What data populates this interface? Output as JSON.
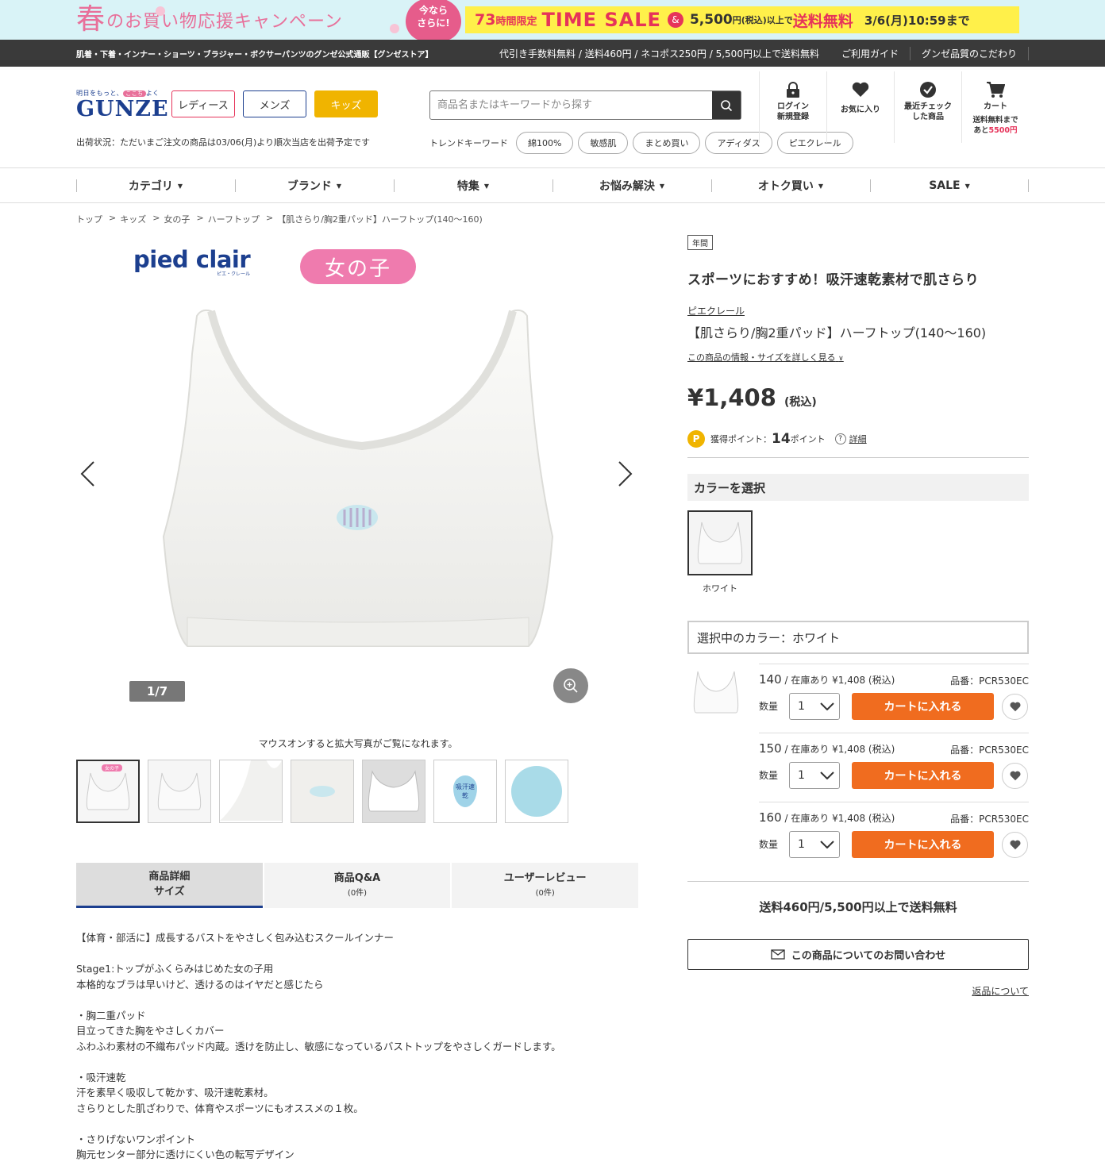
{
  "banner": {
    "spring_big": "春",
    "spring_rest": "のお買い物応援キャンペーン",
    "badge_l1": "今なら",
    "badge_l2": "さらに!",
    "hours": "73",
    "hours_suffix": "時間限定",
    "time_sale": "TIME SALE",
    "amp": "&",
    "threshold": "5,500",
    "threshold_suffix": "円(税込)以上で",
    "free": "送料無料",
    "date": "3/6(月)10:59まで"
  },
  "infobar": {
    "left": "肌着・下着・インナー・ショーツ・ブラジャー・ボクサーパンツのグンゼ公式通販【グンゼストア】",
    "shipping": "代引き手数料無料 / 送料460円 / ネコポス250円 / 5,500円以上で送料無料",
    "guide": "ご利用ガイド",
    "quality": "グンゼ品質のこだわり"
  },
  "header": {
    "logo_tag_pre": "明日をもっと、",
    "logo_tag_mid": "ここち",
    "logo_tag_post": "よく",
    "logo_word": "GUNZE",
    "ladies": "レディース",
    "mens": "メンズ",
    "kids": "キッズ",
    "ship_status": "出荷状況：ただいまご注文の商品は03/06(月)より順次当店を出荷予定です",
    "search_placeholder": "商品名またはキーワードから探す",
    "trend_label": "トレンドキーワード",
    "trends": [
      "綿100%",
      "敏感肌",
      "まとめ買い",
      "アディダス",
      "ピエクレール"
    ],
    "icons": {
      "login_l1": "ログイン",
      "login_l2": "新規登録",
      "fav": "お気に入り",
      "recent_l1": "最近チェック",
      "recent_l2": "した商品",
      "cart": "カート",
      "cart_note_l1": "送料無料まで",
      "cart_note_pre": "あと",
      "cart_note_amount": "5500円"
    }
  },
  "nav": [
    "カテゴリ",
    "ブランド",
    "特集",
    "お悩み解決",
    "オトク買い",
    "SALE"
  ],
  "breadcrumb": [
    "トップ",
    "キッズ",
    "女の子",
    "ハーフトップ",
    "【肌さらり/胸2重パッド】ハーフトップ(140〜160)"
  ],
  "gallery": {
    "brand_logo": "pied clair",
    "brand_logo_kana": "ピエ・クレール",
    "girl_label": "女の子",
    "counter": "1/7",
    "hover_note": "マウスオンすると拡大写真がご覧になれます。",
    "thumb_badge": "女の子",
    "thumb_drop": "吸汗速乾"
  },
  "tabs": [
    {
      "l1": "商品詳細",
      "l2": "サイズ"
    },
    {
      "l1": "商品Q&A",
      "l2": "(0件)"
    },
    {
      "l1": "ユーザーレビュー",
      "l2": "(0件)"
    }
  ],
  "description": [
    "【体育・部活に】成長するバストをやさしく包み込むスクールインナー",
    "",
    "Stage1:トップがふくらみはじめた女の子用",
    "本格的なブラは早いけど、透けるのはイヤだと感じたら",
    "",
    "・胸二重パッド",
    "目立ってきた胸をやさしくカバー",
    "ふわふわ素材の不織布パッド内蔵。透けを防止し、敏感になっているバストトップをやさしくガードします。",
    "",
    "・吸汗速乾",
    "汗を素早く吸収して乾かす、吸汗速乾素材。",
    "さらりとした肌ざわりで、体育やスポーツにもオススメの１枚。",
    "",
    "・さりげないワンポイント",
    "胸元センター部分に透けにくい色の転写デザイン"
  ],
  "product": {
    "season_tag": "年間",
    "catch": "スポーツにおすすめ！吸汗速乾素材で肌さらり",
    "brand": "ピエクレール",
    "name": "【肌さらり/胸2重パッド】ハーフトップ(140〜160)",
    "more_link": "この商品の情報・サイズを詳しく見る",
    "price": "¥1,408",
    "price_tax": "(税込)",
    "points_icon": "P",
    "points_label": "獲得ポイント：",
    "points_value": "14",
    "points_unit": "ポイント",
    "points_help": "?",
    "points_detail": "詳細",
    "color_heading": "カラーを選択",
    "color_name": "ホワイト",
    "selected_color": "選択中のカラー：ホワイト",
    "sizes": [
      {
        "size": "140",
        "stock": " / 在庫あり ¥1,408 (税込)",
        "code": "品番：PCR530EC",
        "qty_label": "数量",
        "qty": "1",
        "cart": "カートに入れる"
      },
      {
        "size": "150",
        "stock": " / 在庫あり ¥1,408 (税込)",
        "code": "品番：PCR530EC",
        "qty_label": "数量",
        "qty": "1",
        "cart": "カートに入れる"
      },
      {
        "size": "160",
        "stock": " / 在庫あり ¥1,408 (税込)",
        "code": "品番：PCR530EC",
        "qty_label": "数量",
        "qty": "1",
        "cart": "カートに入れる"
      }
    ],
    "shipping_note": "送料460円/5,500円以上で送料無料",
    "inquiry": "この商品についてのお問い合わせ",
    "returns": "返品について"
  },
  "colors": {
    "accent_orange": "#f06c1f",
    "brand_navy": "#1c3f8f",
    "kids_yellow": "#f0b400",
    "sale_pink": "#e6335a"
  }
}
